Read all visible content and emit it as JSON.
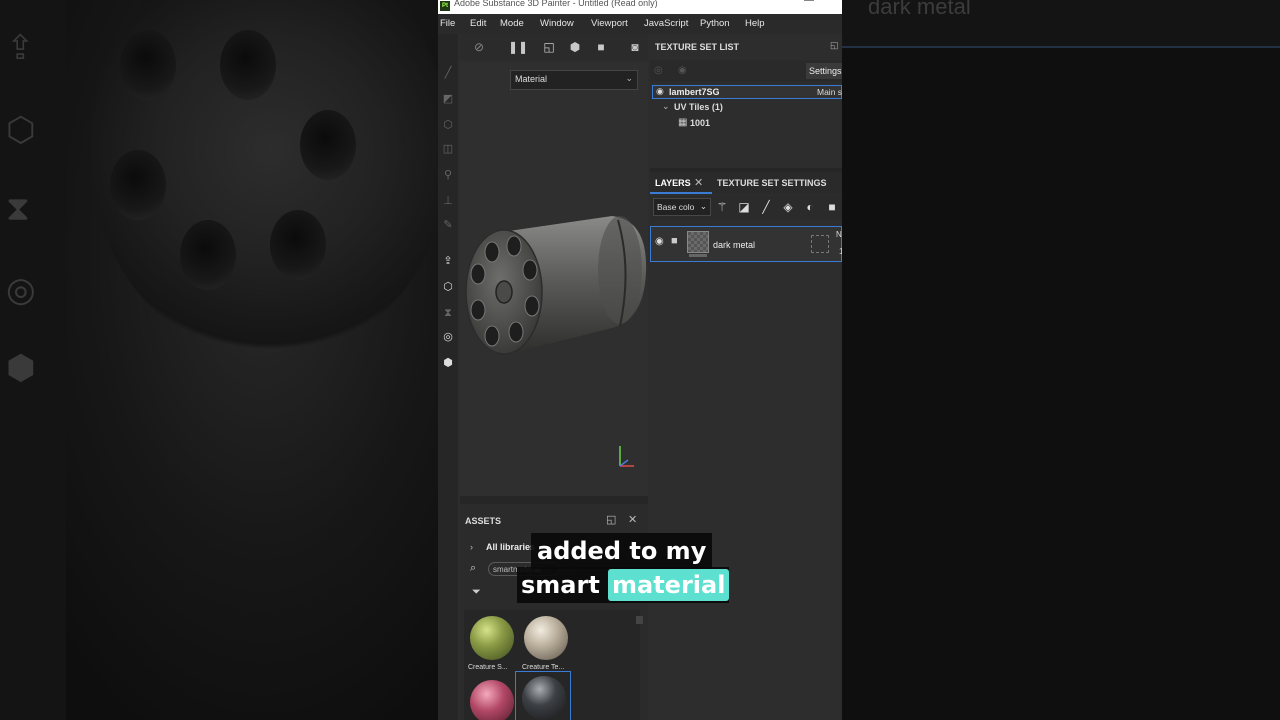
{
  "window": {
    "title": "Adobe Substance 3D Painter - Untitled (Read only)",
    "minimize_glyph": "—"
  },
  "menu": [
    "File",
    "Edit",
    "Mode",
    "Window",
    "Viewport",
    "JavaScript",
    "Python",
    "Help"
  ],
  "viewport": {
    "mode_select": "Material"
  },
  "texture_set_list": {
    "title": "TEXTURE SET LIST",
    "settings_label": "Settings",
    "selected_set": "lambert7SG",
    "shader": "Main sh",
    "uv_tiles": "UV Tiles (1)",
    "tile": "1001"
  },
  "layers": {
    "tab_layers": "LAYERS",
    "tab_texture_set_settings": "TEXTURE SET SETTINGS",
    "channel_select": "Base colo",
    "layer_name": "dark metal",
    "blend_mode": "N",
    "opacity": "1"
  },
  "assets": {
    "title": "ASSETS",
    "library": "All libraries",
    "search_value": "smartmaterial",
    "search_placeholder": "Search",
    "items": [
      {
        "label": "Creature S...",
        "color": "#8a9a45"
      },
      {
        "label": "Creature Te...",
        "color": "#b8ad9a"
      },
      {
        "label": "",
        "color": "#b24866"
      },
      {
        "label": "",
        "color": "#3d4044"
      }
    ]
  },
  "background": {
    "right_ghost_text": "dark metal"
  },
  "caption": {
    "line1": "added to my",
    "line2_word": "smart",
    "line2_highlight": "material",
    "highlight_color": "#5ee0d0"
  }
}
